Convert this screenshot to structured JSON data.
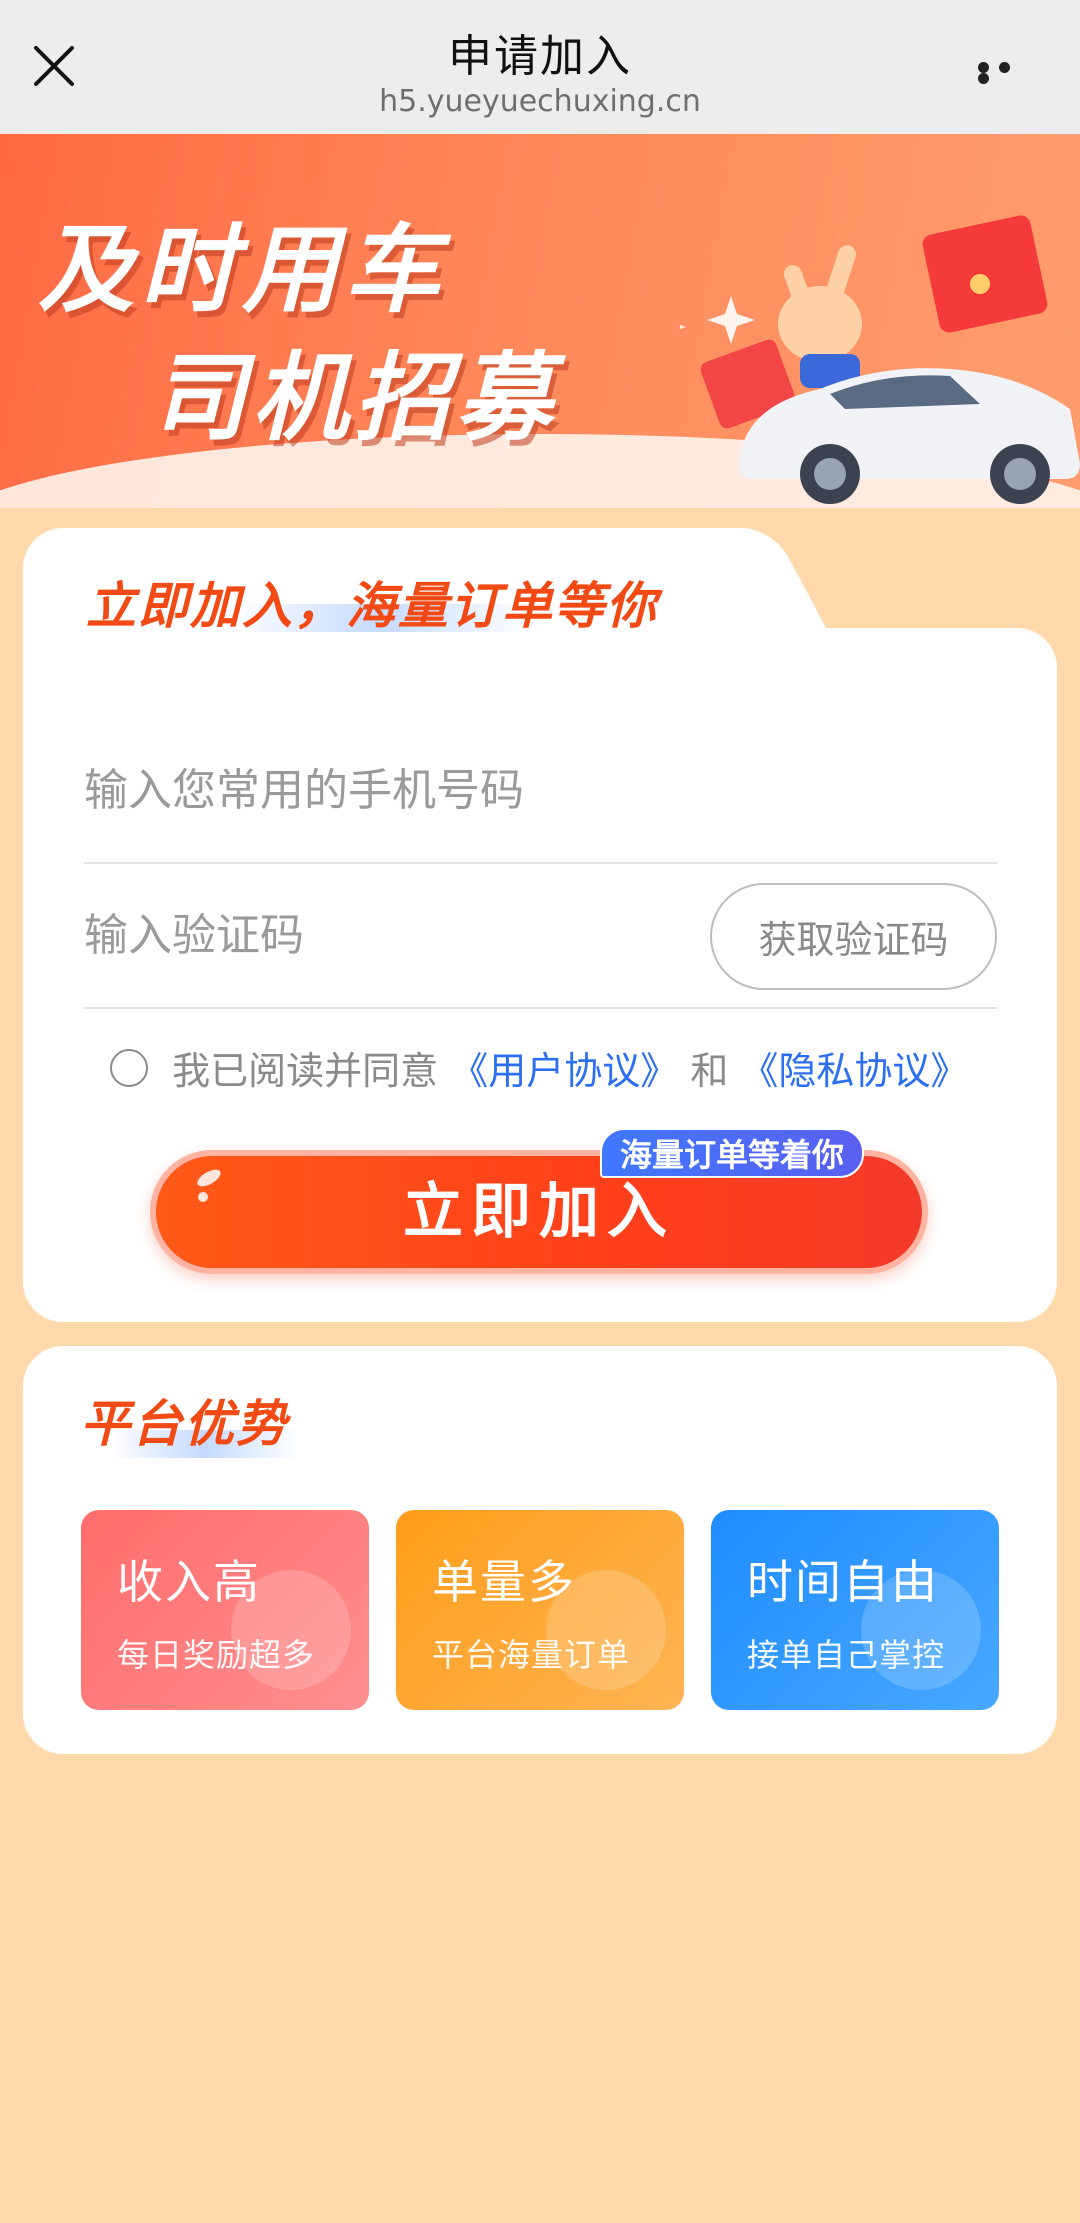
{
  "nav": {
    "title": "申请加入",
    "url": "h5.yueyuechuxing.cn"
  },
  "banner": {
    "line1": "及时用车",
    "line2": "司机招募"
  },
  "form": {
    "heading": "立即加入，海量订单等你",
    "phone_placeholder": "输入您常用的手机号码",
    "code_placeholder": "输入验证码",
    "get_code_label": "获取验证码",
    "agree_prefix": "我已阅读并同意",
    "user_agreement": "《用户协议》",
    "and": "和",
    "privacy_agreement": "《隐私协议》",
    "join_label": "立即加入",
    "join_badge": "海量订单等着你"
  },
  "advantages": {
    "heading": "平台优势",
    "items": [
      {
        "title": "收入高",
        "subtitle": "每日奖励超多",
        "color": "#ff7676"
      },
      {
        "title": "单量多",
        "subtitle": "平台海量订单",
        "color": "#ffa32a"
      },
      {
        "title": "时间自由",
        "subtitle": "接单自己掌控",
        "color": "#2b94ff"
      }
    ]
  },
  "colors": {
    "page_bg": "#ffd9ab",
    "accent": "#f24a14",
    "link": "#2d6ff2"
  }
}
